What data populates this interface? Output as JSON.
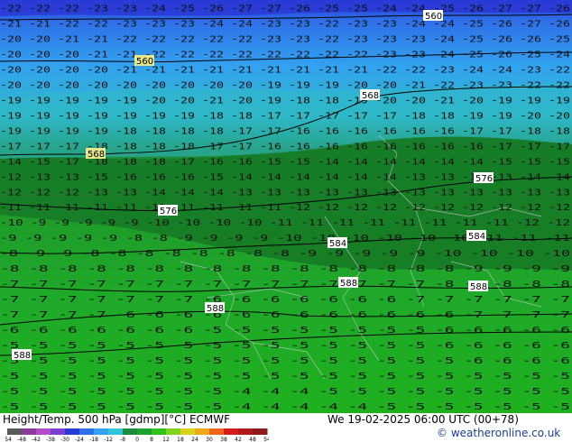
{
  "footer": {
    "title": "Height/Temp. 500 hPa [gdmp][°C] ECMWF",
    "valid_time": "We 19-02-2025 06:00 UTC (00+78)",
    "credit": "© weatheronline.co.uk"
  },
  "colorbar": {
    "ticks": [
      "-54",
      "-48",
      "-42",
      "-38",
      "-30",
      "-24",
      "-18",
      "-12",
      "-8",
      "0",
      "8",
      "12",
      "18",
      "24",
      "30",
      "38",
      "42",
      "48",
      "54"
    ],
    "colors": [
      "#5a5a5a",
      "#8c3a9e",
      "#b44cc8",
      "#7a3fd0",
      "#2a3ad6",
      "#2f6fe8",
      "#33a2f0",
      "#2fc4d8",
      "#1e8c3e",
      "#1fa330",
      "#2fc21a",
      "#7ed41a",
      "#d8d21a",
      "#f0a81a",
      "#f0641a",
      "#d81a1a",
      "#b01a1a",
      "#8c1a1a"
    ]
  },
  "map": {
    "colors": {
      "cold_band": "#2a3ad6",
      "blue_band": "#2f6fe8",
      "light_blue_band": "#33a2f0",
      "teal_band": "#2fb8c8",
      "dark_green": "#167a26",
      "green": "#1f9a2a",
      "bright_green": "#1fb01f",
      "highlight": "#e6e68c"
    },
    "contour_labels": [
      "560",
      "560",
      "568",
      "568",
      "576",
      "576",
      "584",
      "584",
      "588",
      "588",
      "588",
      "588"
    ],
    "temperature_rows": [
      "-22 -22 -22 -23 -23 -24 -25 -26 -27 -27 -26 -25 -25 -24 -24 -25 -26 -27 -27 -26",
      "-21 -21 -22 -22 -23 -23 -23 -24 -24 -23 -23 -22 -23 -23 -24 -24 -25 -26 -27 -26",
      "-20 -20 -21 -21 -22 -22 -22 -22 -22 -23 -23 -22 -23 -23 -23 -24 -25 -26 -26 -25",
      "-20 -20 -20 -21 -21 -22 -22 -22 -22 -22 -22 -22 -22 -23 -23 -24 -25 -26 -25 -24",
      "-20 -20 -20 -20 -21 -21 -21 -21 -21 -21 -21 -21 -21 -22 -22 -23 -24 -24 -23 -22",
      "-20 -20 -20 -20 -20 -20 -20 -20 -20 -19 -19 -19 -20 -20 -21 -22 -23 -23 -22 -22",
      "-19 -19 -19 -19 -19 -20 -20 -21 -20 -19 -18 -18 -19 -20 -20 -21 -20 -19 -19 -19",
      "-19 -19 -19 -19 -19 -19 -19 -18 -18 -17 -17 -17 -17 -17 -18 -18 -19 -19 -20 -20",
      "-19 -19 -19 -19 -18 -18 -18 -18 -17 -17 -16 -16 -16 -16 -16 -16 -17 -17 -18 -18",
      "-17 -17 -17 -18 -18 -18 -18 -17 -17 -16 -16 -16 -16 -16 -16 -16 -16 -17 -17 -17",
      "-14 -15 -17 -18 -18 -18 -17 -16 -16 -15 -15 -14 -14 -14 -14 -14 -14 -15 -15 -15",
      "-12 -13 -13 -15 -16 -16 -16 -15 -14 -14 -14 -14 -14 -14 -13 -13 -13 -13 -14 -14",
      "-12 -12 -12 -13 -13 -14 -14 -14 -13 -13 -13 -13 -13 -13 -13 -13 -13 -13 -13 -13",
      "-11 -11 -11 -11 -11 -11 -11 -11 -11 -11 -12 -12 -12 -12 -12 -12 -12 -12 -12 -12",
      "-10 -9 -9 -9 -9 -9 -10 -10 -10 -10 -11 -11 -11 -11 -11 -11 -11 -11 -12 -12",
      "-9 -9 -9 -9 -9 -8 -8 -9 -9 -9 -9 -10 -10 -10 -10 -10 -10 -11 -11 -11",
      "-8 -9 -9 -8 -8 -8 -8 -8 -8 -8 -8 -9 -9 -9 -9 -9 -10 -10 -10 -10",
      "-8 -8 -8 -8 -8 -8 -8 -8 -8 -8 -8 -8 -8 -8 -8 -8 -9 -9 -9 -9",
      "-7 -7 -7 -7 -7 -7 -7 -7 -7 -7 -7 -7 -7 -7 -7 -8 -8 -8 -8 -8",
      "-7 -7 -7 -7 -7 -7 -7 -6 -6 -6 -6 -6 -6 -6 -7 -7 -7 -7 -7 -7",
      "-7 -7 -7 -7 -6 -6 -6 -6 -6 -6 -6 -6 -6 -6 -6 -6 -7 -7 -7 -7",
      "-6 -6 -6 -6 -6 -6 -6 -5 -5 -5 -5 -5 -5 -5 -5 -6 -6 -6 -6 -6",
      "-5 -5 -5 -5 -5 -5 -5 -5 -5 -5 -5 -5 -5 -5 -5 -6 -6 -6 -6 -6",
      "-5 -5 -5 -5 -5 -5 -5 -5 -5 -5 -5 -5 -5 -5 -5 -5 -6 -6 -6 -6",
      "-5 -5 -5 -5 -5 -5 -5 -5 -5 -5 -5 -5 -5 -5 -5 -5 -5 -5 -5 -5",
      "-5 -5 -5 -5 -5 -5 -5 -5 -4 -4 -4 -5 -5 -5 -5 -5 -5 -5 -5 -5",
      "-5 -5 -5 -5 -5 -5 -5 -5 -4 -4 -4 -4 -4 -5 -5 -5 -5 -5 -5 -5"
    ]
  }
}
